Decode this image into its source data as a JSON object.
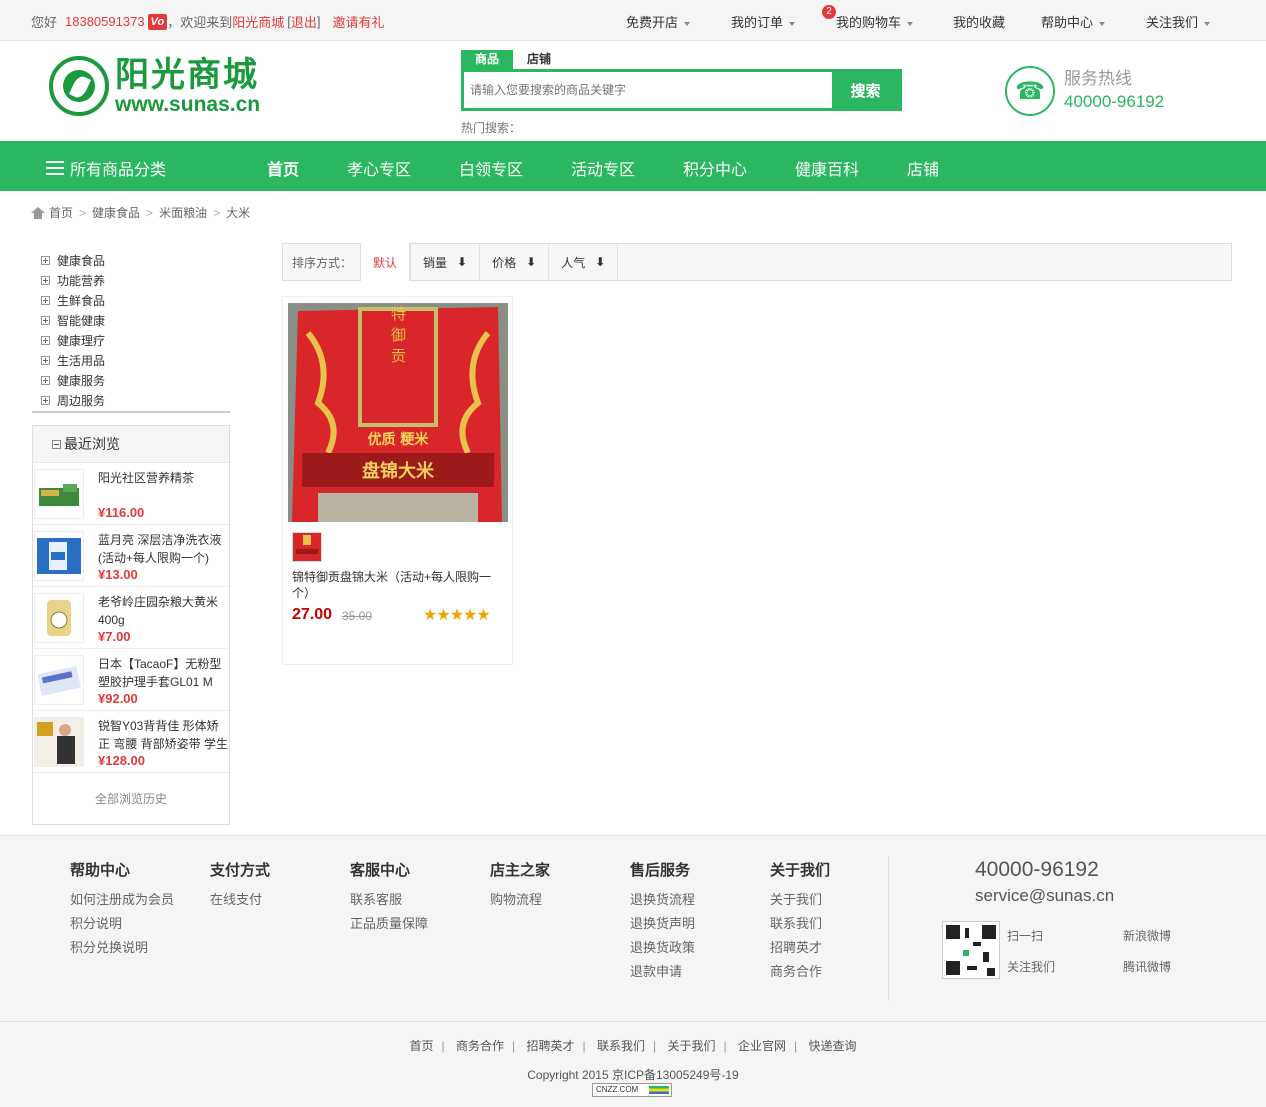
{
  "topbar": {
    "greeting": "您好",
    "phone": "18380591373",
    "vip_badge": "Vo",
    "welcome_prefix": "，欢迎来到",
    "site_name": "阳光商城",
    "logout_open": "[",
    "logout": "退出",
    "logout_close": "]",
    "invite": "邀请有礼",
    "menu": {
      "open_shop": "免费开店",
      "my_orders": "我的订单",
      "cart": "我的购物车",
      "cart_count": "2",
      "favorites": "我的收藏",
      "help": "帮助中心",
      "follow": "关注我们"
    }
  },
  "header": {
    "logo_cn": "阳光商城",
    "logo_en": "www.sunas.cn",
    "search": {
      "tab_goods": "商品",
      "tab_shops": "店铺",
      "placeholder": "请输入您要搜索的商品关键字",
      "button": "搜索",
      "hot_label": "热门搜索："
    },
    "hotline": {
      "label": "服务热线",
      "number": "40000-96192"
    }
  },
  "nav": {
    "all_categories": "所有商品分类",
    "items": [
      "首页",
      "孝心专区",
      "白领专区",
      "活动专区",
      "积分中心",
      "健康百科",
      "店铺"
    ]
  },
  "breadcrumb": [
    "首页",
    "健康食品",
    "米面粮油",
    "大米"
  ],
  "categories": [
    "健康食品",
    "功能营养",
    "生鲜食品",
    "智能健康",
    "健康理疗",
    "生活用品",
    "健康服务",
    "周边服务"
  ],
  "recent": {
    "title": "最近浏览",
    "items": [
      {
        "name": "阳光社区营养精茶",
        "price": "¥116.00"
      },
      {
        "name": "蓝月亮 深层洁净洗衣液(活动+每人限购一个)",
        "price": "¥13.00"
      },
      {
        "name": "老爷岭庄园杂粮大黄米400g",
        "price": "¥7.00"
      },
      {
        "name": "日本【TacaoF】无粉型塑胶护理手套GL01 M",
        "price": "¥92.00"
      },
      {
        "name": "锐智Y03背背佳 形体矫正 弯腰 背部矫姿带 学生",
        "price": "¥128.00"
      }
    ],
    "all_history": "全部浏览历史"
  },
  "sort": {
    "label": "排序方式：",
    "default": "默认",
    "sales": "销量",
    "price": "价格",
    "popularity": "人气"
  },
  "product": {
    "package_text_1": "锦特御贡",
    "package_text_2": "优质  粳米",
    "package_text_3": "盘锦大米",
    "name": "锦特御贡盘锦大米（活动+每人限购一个）",
    "price": "27.00",
    "old_price": "35.00",
    "rating": 5
  },
  "footer": {
    "columns": [
      {
        "title": "帮助中心",
        "links": [
          "如何注册成为会员",
          "积分说明",
          "积分兑换说明"
        ]
      },
      {
        "title": "支付方式",
        "links": [
          "在线支付"
        ]
      },
      {
        "title": "客服中心",
        "links": [
          "联系客服",
          "正品质量保障"
        ]
      },
      {
        "title": "店主之家",
        "links": [
          "购物流程"
        ]
      },
      {
        "title": "售后服务",
        "links": [
          "退换货流程",
          "退换货声明",
          "退换货政策",
          "退款申请"
        ]
      },
      {
        "title": "关于我们",
        "links": [
          "关于我们",
          "联系我们",
          "招聘英才",
          "商务合作"
        ]
      }
    ],
    "phone": "40000-96192",
    "email": "service@sunas.cn",
    "scan": "扫一扫",
    "follow_us": "关注我们",
    "weibo_sina": "新浪微博",
    "weibo_tencent": "腾讯微博",
    "bottom_links": [
      "首页",
      "商务合作",
      "招聘英才",
      "联系我们",
      "关于我们",
      "企业官网",
      "快递查询"
    ],
    "copyright": "Copyright 2015 京ICP备13005249号-19",
    "cnzz": "CNZZ.COM"
  },
  "colors": {
    "brand_green": "#2bb760",
    "logo_green": "#1a9a3c",
    "price_red": "#e4393c"
  }
}
